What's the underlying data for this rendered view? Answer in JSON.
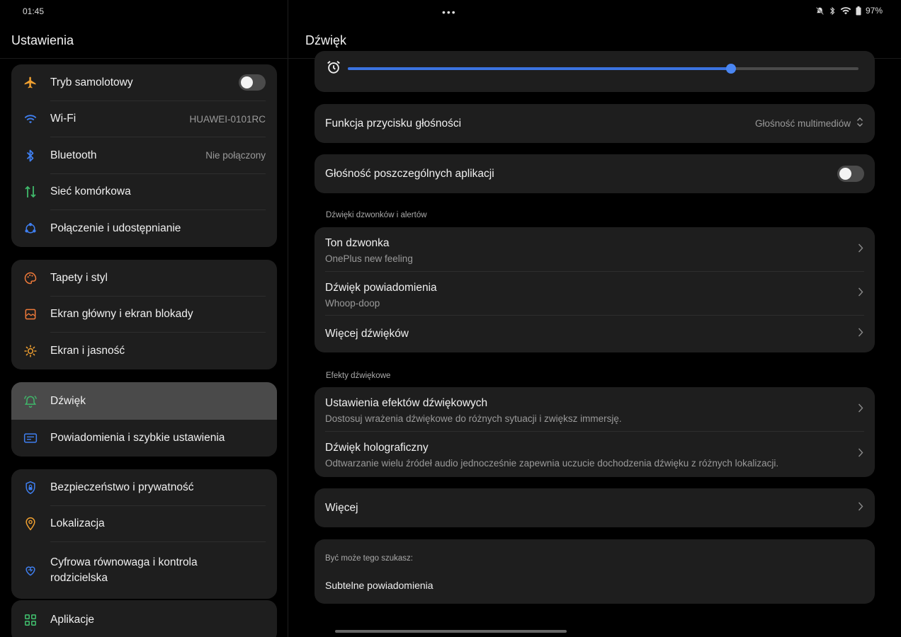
{
  "status": {
    "time": "01:45",
    "dots": "•••",
    "battery": "97%"
  },
  "left": {
    "title": "Ustawienia",
    "groups": [
      {
        "items": [
          {
            "label": "Tryb samolotowy",
            "icon": "airplane-icon"
          },
          {
            "label": "Wi-Fi",
            "value": "HUAWEI-0101RC",
            "icon": "wifi-icon"
          },
          {
            "label": "Bluetooth",
            "value": "Nie połączony",
            "icon": "bluetooth-icon"
          },
          {
            "label": "Sieć komórkowa",
            "icon": "mobile-data-icon"
          },
          {
            "label": "Połączenie i udostępnianie",
            "icon": "share-icon"
          }
        ]
      },
      {
        "items": [
          {
            "label": "Tapety i styl",
            "icon": "palette-icon"
          },
          {
            "label": "Ekran główny i ekran blokady",
            "icon": "home-screen-icon"
          },
          {
            "label": "Ekran i jasność",
            "icon": "brightness-icon"
          }
        ]
      },
      {
        "items": [
          {
            "label": "Dźwięk",
            "icon": "bell-icon"
          },
          {
            "label": "Powiadomienia i szybkie ustawienia",
            "icon": "notification-icon"
          }
        ]
      },
      {
        "items": [
          {
            "label": "Bezpieczeństwo i prywatność",
            "icon": "shield-lock-icon"
          },
          {
            "label": "Lokalizacja",
            "icon": "location-pin-icon"
          },
          {
            "label": "Cyfrowa równowaga i kontrola rodzicielska",
            "icon": "wellbeing-icon"
          }
        ]
      },
      {
        "items": [
          {
            "label": "Aplikacje",
            "icon": "apps-grid-icon"
          }
        ]
      }
    ]
  },
  "right": {
    "title": "Dźwięk",
    "alarm_slider": {
      "level_percent": 75,
      "icon": "alarm-clock-icon"
    },
    "volume_key": {
      "label": "Funkcja przycisku głośności",
      "value": "Głośność multimediów"
    },
    "per_app": {
      "label": "Głośność poszczególnych aplikacji"
    },
    "section_ringtones": "Dźwięki dzwonków i alertów",
    "ringtones": [
      {
        "title": "Ton dzwonka",
        "subtitle": "OnePlus new feeling"
      },
      {
        "title": "Dźwięk powiadomienia",
        "subtitle": "Whoop-doop"
      },
      {
        "title": "Więcej dźwięków"
      }
    ],
    "section_effects": "Efekty dźwiękowe",
    "effects": [
      {
        "title": "Ustawienia efektów dźwiękowych",
        "subtitle": "Dostosuj wrażenia dźwiękowe do różnych sytuacji i zwiększ immersję."
      },
      {
        "title": "Dźwięk holograficzny",
        "subtitle": "Odtwarzanie wielu źródeł audio jednocześnie zapewnia uczucie dochodzenia dźwięku z różnych lokalizacji."
      }
    ],
    "more": {
      "title": "Więcej"
    },
    "suggest": {
      "heading": "Być może tego szukasz:",
      "item": "Subtelne powiadomienia"
    }
  },
  "colors": {
    "accent": "#3b73e0",
    "card": "#1e1e1e",
    "active": "#4a4a4a"
  }
}
